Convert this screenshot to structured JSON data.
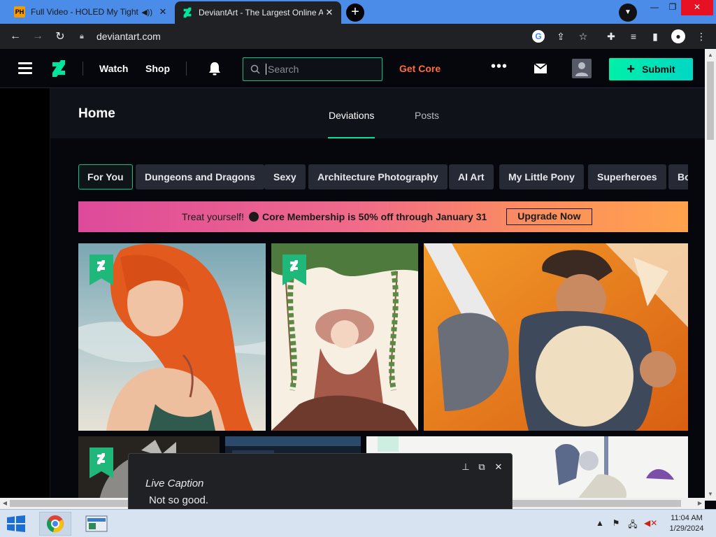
{
  "browser": {
    "tabs": [
      {
        "title": "Full Video - HOLED My Tight",
        "favicon_label": "PH"
      },
      {
        "title": "DeviantArt - The Largest Online Art"
      }
    ],
    "url": "deviantart.com"
  },
  "header": {
    "watch": "Watch",
    "shop": "Shop",
    "search_placeholder": "Search",
    "get_core": "Get Core",
    "more": "•••",
    "submit": "Submit"
  },
  "home": {
    "title": "Home",
    "tabs": [
      "Deviations",
      "Posts"
    ]
  },
  "chips": [
    "For You",
    "Dungeons and Dragons",
    "Sexy",
    "Architecture Photography",
    "AI Art",
    "My Little Pony",
    "Superheroes",
    "Bo"
  ],
  "promo": {
    "lead": "Treat yourself!",
    "text": "Core Membership is 50% off through January 31",
    "button": "Upgrade Now"
  },
  "live_caption": {
    "title": "Live Caption",
    "text": "Not so good."
  },
  "taskbar": {
    "time": "11:04 AM",
    "date": "1/29/2024"
  },
  "colors": {
    "accent": "#00e59b",
    "get_core": "#ff6b3d",
    "tabstrip": "#4a8ce8"
  }
}
